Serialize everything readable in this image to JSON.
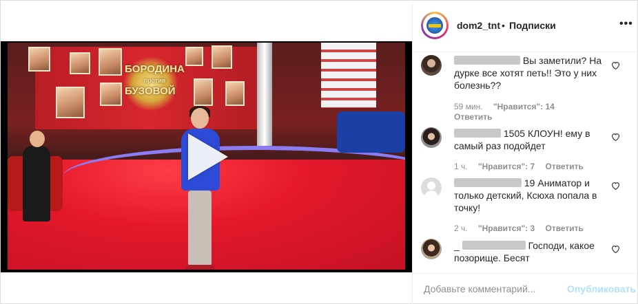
{
  "header": {
    "username": "dom2_tnt",
    "separator": "•",
    "follow_label": "Подписки",
    "more_label": "•••"
  },
  "video": {
    "banner_line1": "БОРОДИНА",
    "banner_line2": "против",
    "banner_line3": "БУЗОВОЙ"
  },
  "comments": [
    {
      "text": "Вы заметили? На дурке все хотят петь!! Это у них болезнь??",
      "time": "59 мин.",
      "likes": "\"Нравится\": 14",
      "reply": "Ответить"
    },
    {
      "text_prefix": "1505",
      "text": "КЛОУН! ему в самый раз подойдет",
      "time": "1 ч.",
      "likes": "\"Нравится\": 7",
      "reply": "Ответить"
    },
    {
      "text_prefix": "19",
      "text": "Аниматор и только детский, Ксюха попала в точку!",
      "time": "2 ч.",
      "likes": "\"Нравится\": 3",
      "reply": "Ответить"
    },
    {
      "text_prefix": "_",
      "text": "Господи, какое позорище. Бесят"
    }
  ],
  "footer": {
    "placeholder": "Добавьте комментарий...",
    "publish_label": "Опубликовать"
  },
  "colors": {
    "text": "#262626",
    "meta": "#8e8e8e",
    "publish_disabled": "#b2dffc",
    "border": "#dbdbdb"
  }
}
